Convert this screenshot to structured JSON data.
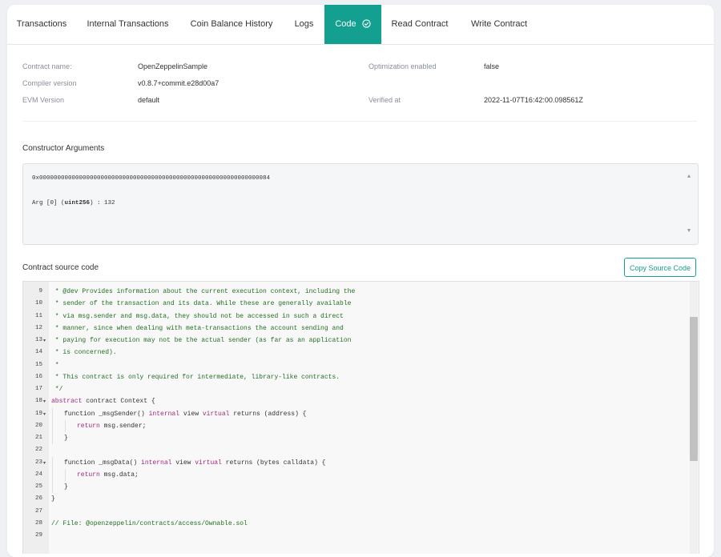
{
  "tabs": [
    {
      "label": "Transactions"
    },
    {
      "label": "Internal Transactions"
    },
    {
      "label": "Coin Balance History"
    },
    {
      "label": "Logs"
    },
    {
      "label": "Code"
    },
    {
      "label": "Read Contract"
    },
    {
      "label": "Write Contract"
    }
  ],
  "active_tab": "Code",
  "contract_info": {
    "contract_name_label": "Contract name:",
    "contract_name": "OpenZeppelinSample",
    "compiler_version_label": "Compiler version",
    "compiler_version": "v0.8.7+commit.e28d00a7",
    "evm_version_label": "EVM Version",
    "evm_version": "default",
    "optimization_label": "Optimization enabled",
    "optimization": "false",
    "verified_at_label": "Verified at",
    "verified_at": "2022-11-07T16:42:00.098561Z"
  },
  "constructor": {
    "title": "Constructor Arguments",
    "hex": "0x0000000000000000000000000000000000000000000000000000000000000084",
    "arg_prefix": "Arg [0] (",
    "arg_type": "uint256",
    "arg_suffix": ") : 132"
  },
  "source": {
    "title": "Contract source code",
    "copy_button": "Copy Source Code",
    "lines": [
      {
        "n": "9",
        "fold": false,
        "indent": 0,
        "text": " * @dev Provides information about the current execution context, including the",
        "kind": "comment"
      },
      {
        "n": "10",
        "fold": false,
        "indent": 0,
        "text": " * sender of the transaction and its data. While these are generally available",
        "kind": "comment"
      },
      {
        "n": "11",
        "fold": false,
        "indent": 0,
        "text": " * via msg.sender and msg.data, they should not be accessed in such a direct",
        "kind": "comment"
      },
      {
        "n": "12",
        "fold": false,
        "indent": 0,
        "text": " * manner, since when dealing with meta-transactions the account sending and",
        "kind": "comment"
      },
      {
        "n": "13",
        "fold": true,
        "indent": 0,
        "text": " * paying for execution may not be the actual sender (as far as an application",
        "kind": "comment"
      },
      {
        "n": "14",
        "fold": false,
        "indent": 0,
        "text": " * is concerned).",
        "kind": "comment"
      },
      {
        "n": "15",
        "fold": false,
        "indent": 0,
        "text": " *",
        "kind": "comment"
      },
      {
        "n": "16",
        "fold": false,
        "indent": 0,
        "text": " * This contract is only required for intermediate, library-like contracts.",
        "kind": "comment"
      },
      {
        "n": "17",
        "fold": false,
        "indent": 0,
        "text": " */",
        "kind": "comment"
      },
      {
        "n": "18",
        "fold": true,
        "indent": 0,
        "kw": "abstract",
        "text": " contract Context {",
        "kind": "code"
      },
      {
        "n": "19",
        "fold": true,
        "indent": 1,
        "pre": "function _msgSender() ",
        "kw": "internal",
        "mid": " view ",
        "kw2": "virtual",
        "text": " returns (address) {",
        "kind": "fn"
      },
      {
        "n": "20",
        "fold": false,
        "indent": 2,
        "kw": "return",
        "text": " msg.sender;",
        "kind": "code"
      },
      {
        "n": "21",
        "fold": false,
        "indent": 1,
        "text": "}",
        "kind": "plain"
      },
      {
        "n": "22",
        "fold": false,
        "indent": 0,
        "text": "",
        "kind": "plain"
      },
      {
        "n": "23",
        "fold": true,
        "indent": 1,
        "pre": "function _msgData() ",
        "kw": "internal",
        "mid": " view ",
        "kw2": "virtual",
        "text": " returns (bytes calldata) {",
        "kind": "fn"
      },
      {
        "n": "24",
        "fold": false,
        "indent": 2,
        "kw": "return",
        "text": " msg.data;",
        "kind": "code"
      },
      {
        "n": "25",
        "fold": false,
        "indent": 1,
        "text": "}",
        "kind": "plain"
      },
      {
        "n": "26",
        "fold": false,
        "indent": 0,
        "text": "}",
        "kind": "plain"
      },
      {
        "n": "27",
        "fold": false,
        "indent": 0,
        "text": "",
        "kind": "plain"
      },
      {
        "n": "28",
        "fold": false,
        "indent": 0,
        "text": "// File: @openzeppelin/contracts/access/Ownable.sol",
        "kind": "comment"
      },
      {
        "n": "29",
        "fold": false,
        "indent": 0,
        "text": "",
        "kind": "plain"
      }
    ]
  },
  "icons": {
    "verified": "check-circle-icon",
    "fold": "fold-arrow-icon"
  },
  "colors": {
    "accent": "#14a090",
    "comment": "#236e24",
    "keyword": "#a3267c"
  }
}
